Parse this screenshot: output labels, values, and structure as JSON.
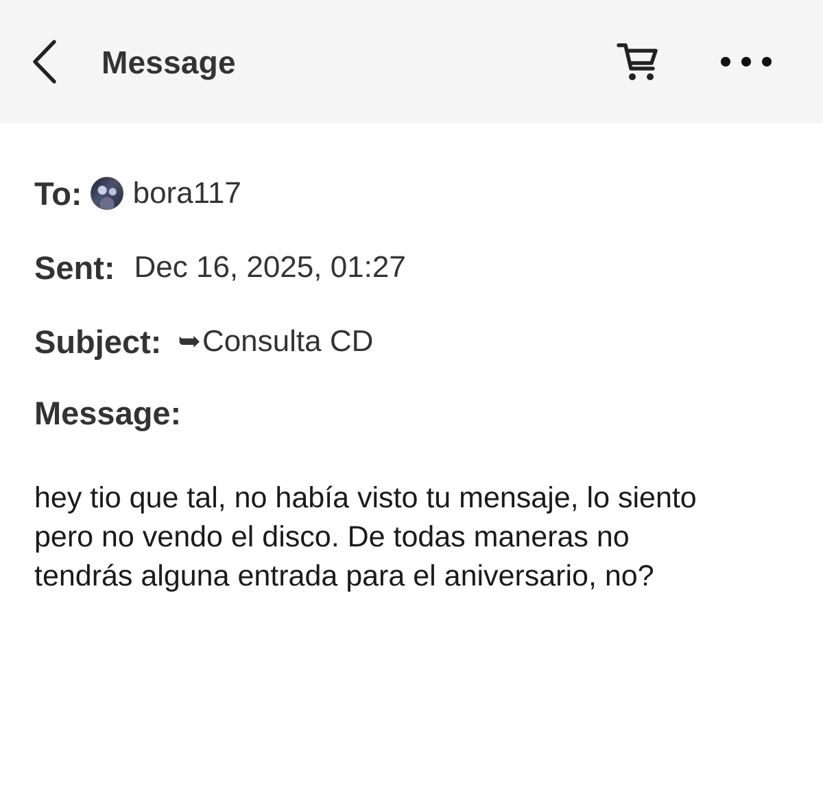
{
  "header": {
    "title": "Message",
    "back_icon": "chevron-left-icon",
    "cart_icon": "shopping-cart-icon",
    "more_icon": "more-horizontal-icon",
    "background": "#f5f5f5"
  },
  "message": {
    "to_label": "To:",
    "to_value": "bora117",
    "sent_label": "Sent:",
    "sent_value": "Dec 16, 2025, 01:27",
    "subject_label": "Subject:",
    "subject_arrow": "➥",
    "subject_value": "Consulta CD",
    "message_label": "Message:",
    "body": "hey tio que tal, no había visto tu mensaje, lo siento\npero no vendo el disco. De todas maneras no\ntendrás alguna entrada para el aniversario, no?"
  }
}
